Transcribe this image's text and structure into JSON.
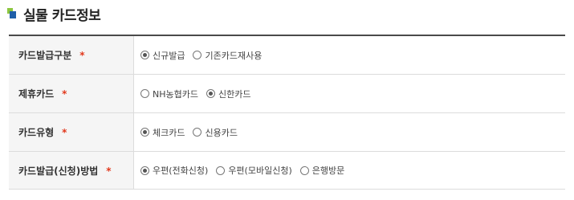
{
  "section": {
    "title": "실물 카드정보"
  },
  "required_mark": "*",
  "rows": [
    {
      "label": "카드발급구분",
      "options": [
        {
          "label": "신규발급",
          "checked": true
        },
        {
          "label": "기존카드재사용",
          "checked": false
        }
      ]
    },
    {
      "label": "제휴카드",
      "options": [
        {
          "label": "NH농협카드",
          "checked": false
        },
        {
          "label": "신한카드",
          "checked": true
        }
      ]
    },
    {
      "label": "카드유형",
      "options": [
        {
          "label": "체크카드",
          "checked": true
        },
        {
          "label": "신용카드",
          "checked": false
        }
      ]
    },
    {
      "label": "카드발급(신청)방법",
      "options": [
        {
          "label": "우편(전화신청)",
          "checked": true
        },
        {
          "label": "우편(모바일신청)",
          "checked": false
        },
        {
          "label": "은행방문",
          "checked": false
        }
      ]
    }
  ]
}
